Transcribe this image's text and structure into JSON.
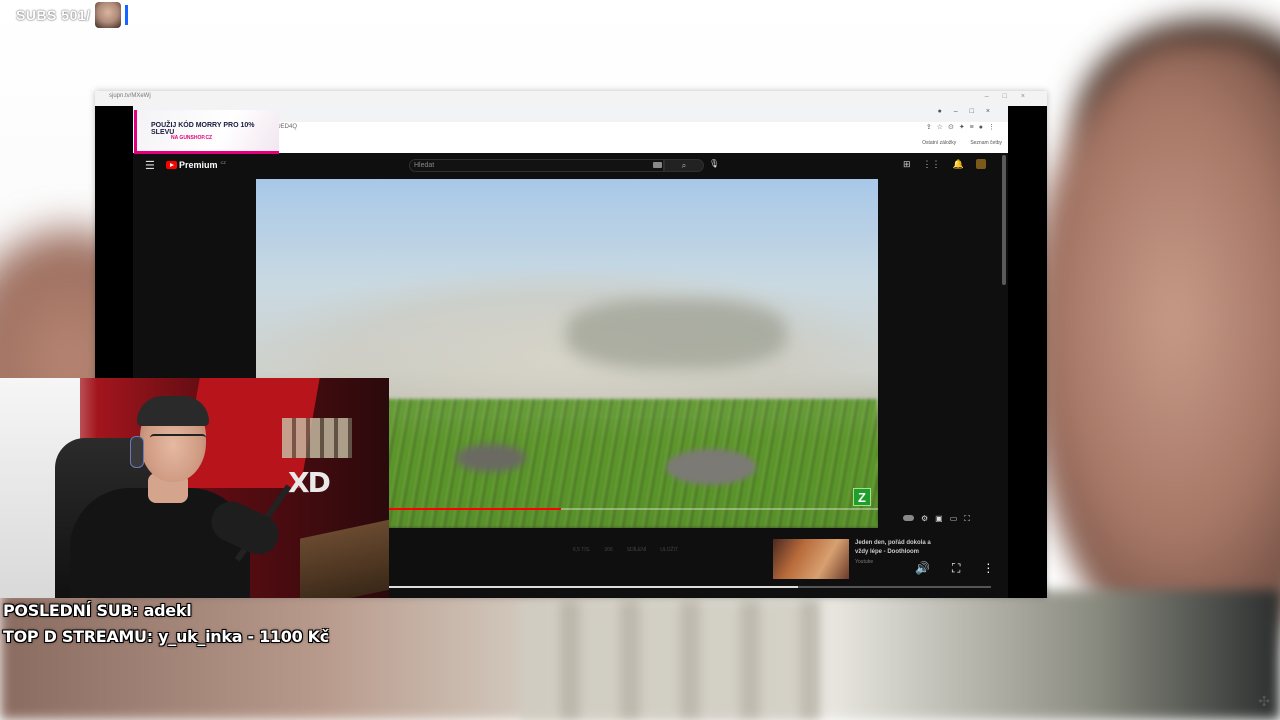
{
  "overlay": {
    "subs_label": "SUBS 501/",
    "last_sub": "POSLEDNÍ SUB: adekl",
    "top_donation": "TOP D STREAMU: y_uk_inka - 1100 Kč"
  },
  "browser": {
    "window_title": "sjupn.tv/MXeWj",
    "address_tail": "7UED4Q",
    "bookmarks": [
      "Ostatní záložky",
      "Seznam četby"
    ]
  },
  "promo": {
    "line1": "POUŽIJ KÓD MORRY PRO 10% SLEVU",
    "line2": "NA GUNSHOP.CZ"
  },
  "youtube": {
    "logo_text": "Premium",
    "logo_sup": "CZ",
    "search_placeholder": "Hledat",
    "badge": "Z",
    "progress_fraction": 0.49,
    "actions": [
      "6,5 TIS.",
      "306",
      "SDÍLENÍ",
      "ULOŽIT"
    ],
    "recommended": {
      "title": "Jeden den, pořád dokola a vždy lépe - Doothloom",
      "channel": "Youtube"
    },
    "mini_progress_fraction": 0.68
  },
  "colors": {
    "yt_red": "#ff0000",
    "promo_accent": "#e3007a",
    "badge_green": "#1e9e2a"
  }
}
